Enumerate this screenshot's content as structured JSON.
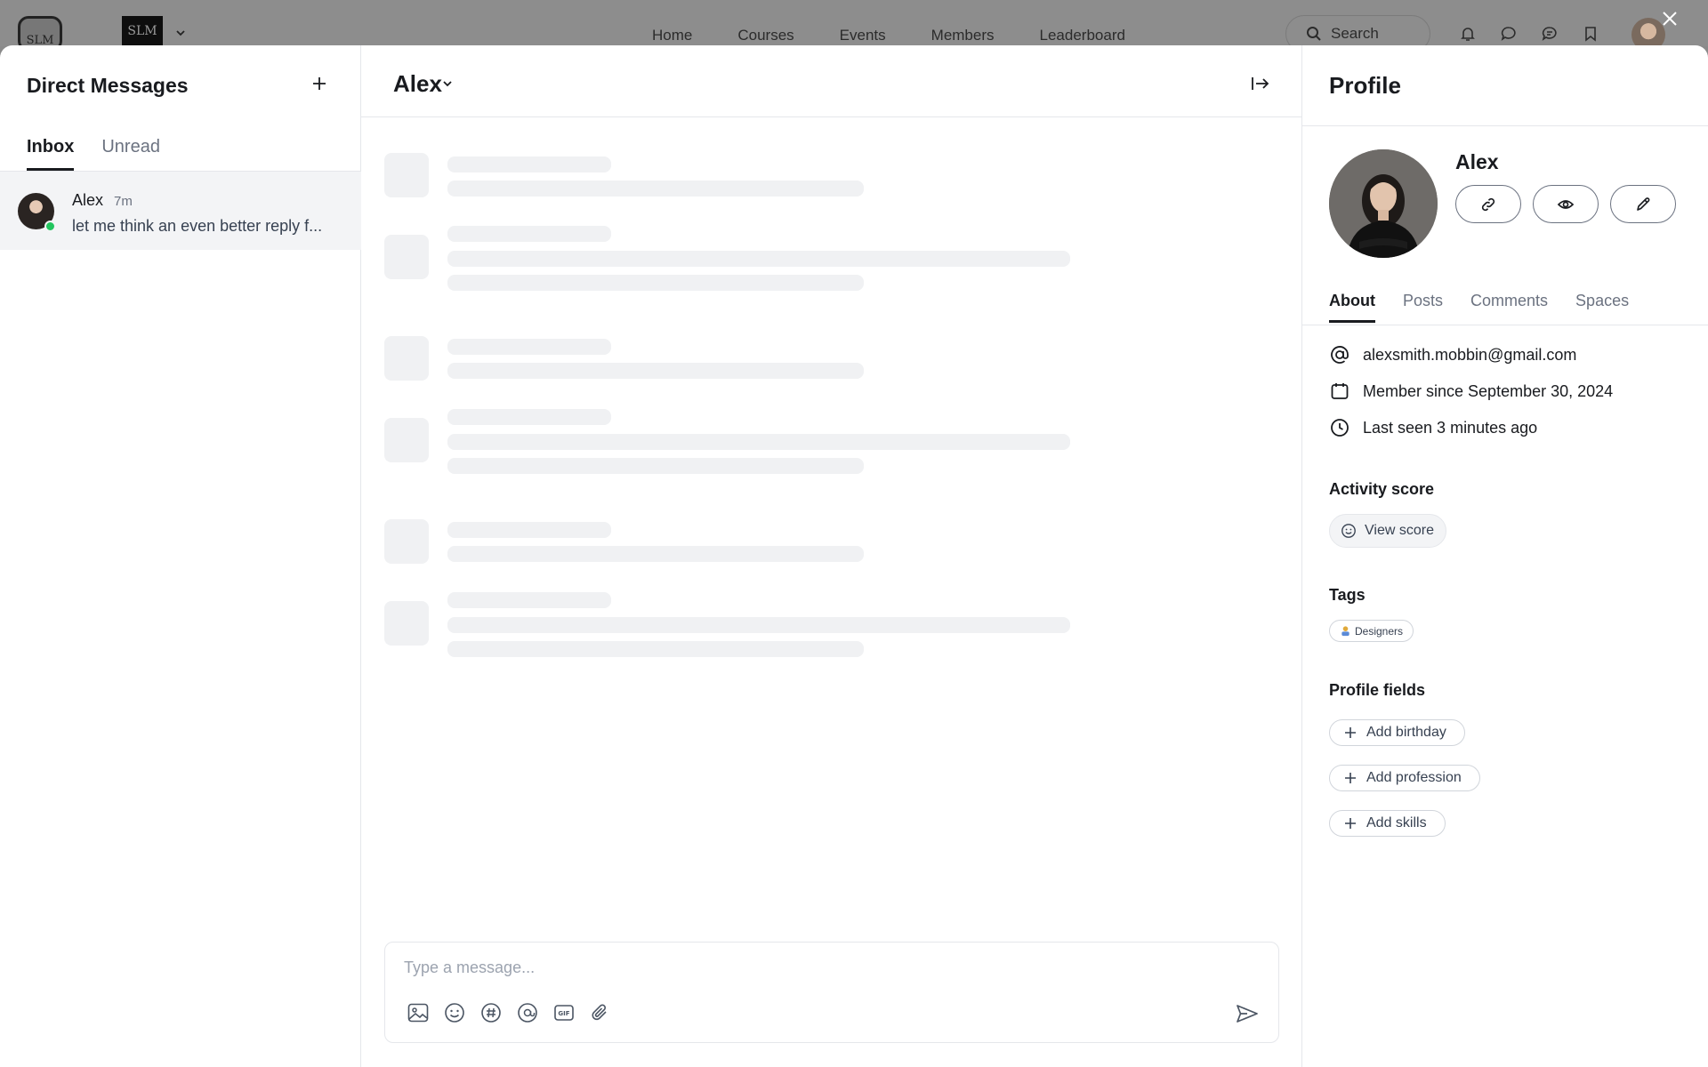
{
  "topbar": {
    "brand_text": "SLM",
    "brand_text2": "SLM",
    "nav": [
      "Home",
      "Courses",
      "Events",
      "Members",
      "Leaderboard"
    ],
    "search_label": "Search"
  },
  "inbox": {
    "title": "Direct Messages",
    "tabs": [
      "Inbox",
      "Unread"
    ],
    "conversations": [
      {
        "name": "Alex",
        "time": "7m",
        "preview": "let me think an even better reply f..."
      }
    ]
  },
  "chat": {
    "title": "Alex",
    "composer_placeholder": "Type a message..."
  },
  "profile": {
    "title": "Profile",
    "name": "Alex",
    "tabs": [
      "About",
      "Posts",
      "Comments",
      "Spaces"
    ],
    "email": "alexsmith.mobbin@gmail.com",
    "member_since": "Member since September 30, 2024",
    "last_seen": "Last seen 3 minutes ago",
    "activity_title": "Activity score",
    "view_score": "View score",
    "tags_title": "Tags",
    "tags": [
      "Designers"
    ],
    "fields_title": "Profile fields",
    "add_fields": [
      "Add birthday",
      "Add profession",
      "Add skills"
    ]
  },
  "colors": {
    "online": "#22c55e",
    "skeleton": "#f0f1f3",
    "overlay": "#8a8a8a"
  }
}
